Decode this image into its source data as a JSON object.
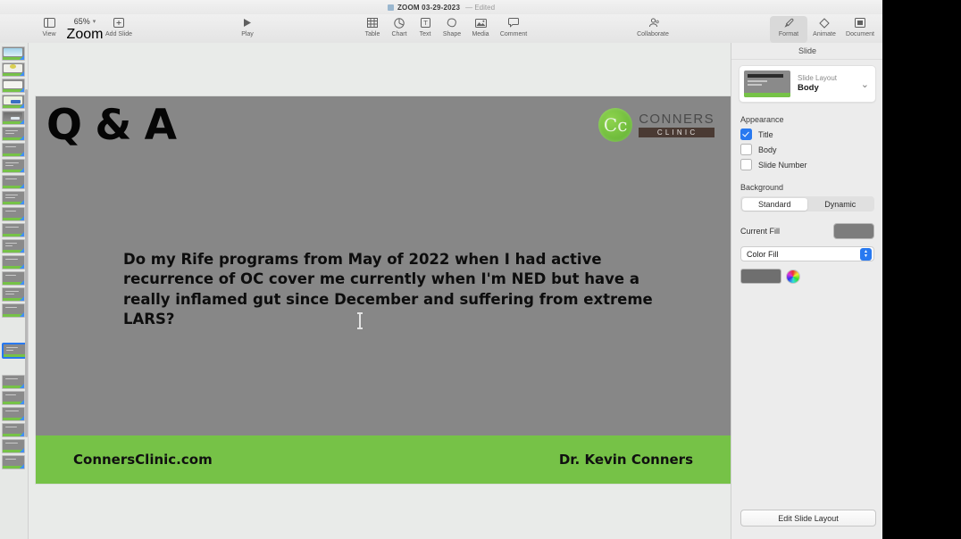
{
  "window": {
    "title": "ZOOM 03-29-2023",
    "edited_label": "— Edited"
  },
  "toolbar": {
    "view": "View",
    "zoom_value": "65%",
    "zoom_label": "Zoom",
    "add_slide": "Add Slide",
    "play": "Play",
    "table": "Table",
    "chart": "Chart",
    "text": "Text",
    "shape": "Shape",
    "media": "Media",
    "comment": "Comment",
    "collaborate": "Collaborate",
    "format": "Format",
    "animate": "Animate",
    "document": "Document"
  },
  "slide": {
    "title": "Q & A",
    "body": "Do my Rife programs from May of 2022 when I had active recurrence of OC cover me currently when I'm NED but have a really inflamed gut since December and suffering from extreme LARS?",
    "logo_monogram": "Cc",
    "logo_word_top": "CONNERS",
    "logo_word_bottom": "CLINIC",
    "footer_left": "ConnersClinic.com",
    "footer_right": "Dr. Kevin Conners",
    "background_color": "#878787",
    "accent_green": "#76c247"
  },
  "inspector": {
    "panel_title": "Slide",
    "slide_layout_label": "Slide Layout",
    "slide_layout_value": "Body",
    "appearance_heading": "Appearance",
    "appearance": [
      {
        "label": "Title",
        "checked": true
      },
      {
        "label": "Body",
        "checked": false
      },
      {
        "label": "Slide Number",
        "checked": false
      }
    ],
    "background_heading": "Background",
    "background_modes": [
      {
        "label": "Standard",
        "selected": true
      },
      {
        "label": "Dynamic",
        "selected": false
      }
    ],
    "current_fill_label": "Current Fill",
    "current_fill_color": "#7d7d7d",
    "fill_type": "Color Fill",
    "fill_color": "#6f6f6f",
    "edit_slide_layout": "Edit Slide Layout"
  },
  "navigator": {
    "selected_index": 9,
    "thumbnails": [
      {
        "kind": "photo"
      },
      {
        "kind": "photo"
      },
      {
        "kind": "text"
      },
      {
        "kind": "chart"
      },
      {
        "kind": "photo"
      },
      {
        "kind": "text"
      },
      {
        "kind": "text"
      },
      {
        "kind": "text"
      },
      {
        "kind": "text"
      },
      {
        "kind": "text"
      },
      {
        "kind": "text"
      },
      {
        "kind": "text"
      },
      {
        "kind": "text"
      },
      {
        "kind": "text"
      },
      {
        "kind": "text"
      }
    ]
  }
}
